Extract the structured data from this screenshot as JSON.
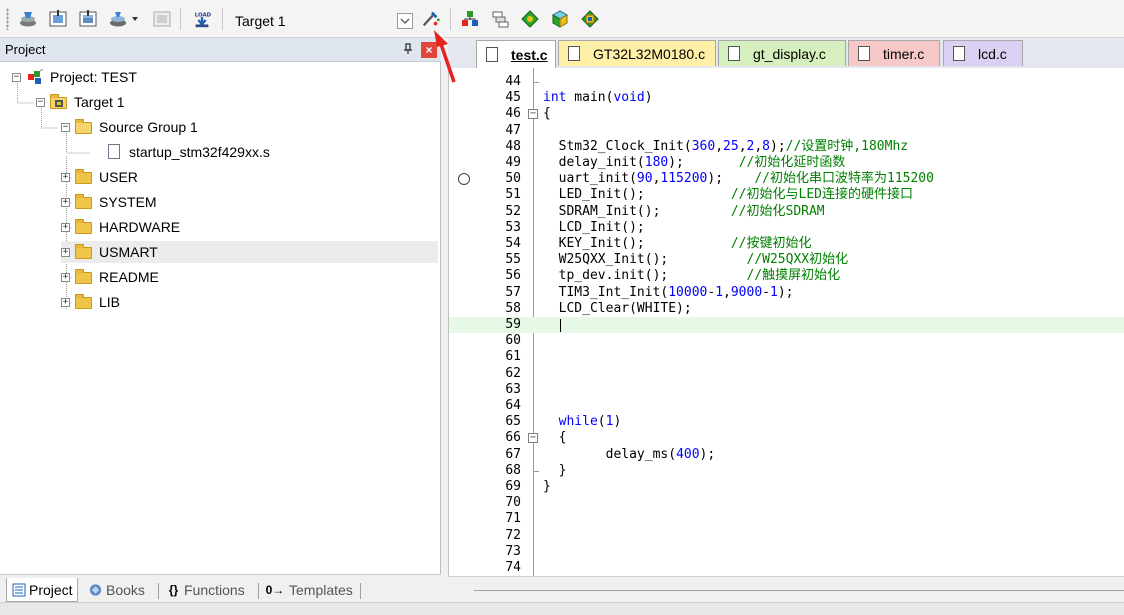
{
  "toolbar": {
    "target_value": "Target 1",
    "load_label": "LOAD"
  },
  "project_pane": {
    "title": "Project",
    "pin_glyph": "ª",
    "close_glyph": "×",
    "tree": [
      {
        "label": "Project: TEST",
        "icon": "project-icon",
        "expander": "−"
      },
      {
        "label": "Target 1",
        "icon": "target-icon",
        "expander": "−"
      },
      {
        "label": "Source Group 1",
        "icon": "folder-open-icon",
        "expander": "−"
      },
      {
        "label": "startup_stm32f429xx.s",
        "icon": "file-icon",
        "expander": ""
      },
      {
        "label": "USER",
        "icon": "folder-icon",
        "expander": "+"
      },
      {
        "label": "SYSTEM",
        "icon": "folder-icon",
        "expander": "+"
      },
      {
        "label": "HARDWARE",
        "icon": "folder-icon",
        "expander": "+"
      },
      {
        "label": "USMART",
        "icon": "folder-icon",
        "expander": "+",
        "selected": true
      },
      {
        "label": "README",
        "icon": "folder-icon",
        "expander": "+"
      },
      {
        "label": "LIB",
        "icon": "folder-icon",
        "expander": "+"
      }
    ],
    "bottom_tabs": [
      {
        "label": "Project",
        "icon": "project-tab-icon",
        "active": true
      },
      {
        "label": "Books",
        "icon": "books-icon"
      },
      {
        "label": "Functions",
        "icon": "functions-icon",
        "glyph": "{}"
      },
      {
        "label": "Templates",
        "icon": "templates-icon",
        "glyph": "0→"
      }
    ]
  },
  "editor_tabs": [
    {
      "label": "test.c",
      "active": true,
      "color": "#ffffff"
    },
    {
      "label": "GT32L32M0180.c",
      "color": "#fff0a8"
    },
    {
      "label": "gt_display.c",
      "color": "#d6efbf"
    },
    {
      "label": "timer.c",
      "color": "#f7c8c8"
    },
    {
      "label": "lcd.c",
      "color": "#d9d0f2"
    }
  ],
  "code_lines": [
    {
      "n": "44",
      "code": ""
    },
    {
      "n": "45",
      "code": "int main(void)"
    },
    {
      "n": "46",
      "code": "{"
    },
    {
      "n": "47",
      "code": ""
    },
    {
      "n": "48",
      "code": "  Stm32_Clock_Init(360,25,2,8);//设置时钟,180Mhz"
    },
    {
      "n": "49",
      "code": "  delay_init(180);       //初始化延时函数"
    },
    {
      "n": "50",
      "code": "  uart_init(90,115200);    //初始化串口波特率为115200"
    },
    {
      "n": "51",
      "code": "  LED_Init();           //初始化与LED连接的硬件接口"
    },
    {
      "n": "52",
      "code": "  SDRAM_Init();         //初始化SDRAM"
    },
    {
      "n": "53",
      "code": "  LCD_Init();"
    },
    {
      "n": "54",
      "code": "  KEY_Init();           //按键初始化"
    },
    {
      "n": "55",
      "code": "  W25QXX_Init();          //W25QXX初始化"
    },
    {
      "n": "56",
      "code": "  tp_dev.init();          //触摸屏初始化"
    },
    {
      "n": "57",
      "code": "  TIM3_Int_Init(10000-1,9000-1);"
    },
    {
      "n": "58",
      "code": "  LCD_Clear(WHITE);"
    },
    {
      "n": "59",
      "code": ""
    },
    {
      "n": "60",
      "code": ""
    },
    {
      "n": "61",
      "code": ""
    },
    {
      "n": "62",
      "code": ""
    },
    {
      "n": "63",
      "code": ""
    },
    {
      "n": "64",
      "code": ""
    },
    {
      "n": "65",
      "code": "  while(1)"
    },
    {
      "n": "66",
      "code": "  {"
    },
    {
      "n": "67",
      "code": "        delay_ms(400);"
    },
    {
      "n": "68",
      "code": "  }"
    },
    {
      "n": "69",
      "code": "}"
    },
    {
      "n": "70",
      "code": ""
    },
    {
      "n": "71",
      "code": ""
    },
    {
      "n": "72",
      "code": ""
    },
    {
      "n": "73",
      "code": ""
    },
    {
      "n": "74",
      "code": ""
    }
  ],
  "colors": {
    "keyword": "#0000ff",
    "comment": "#008000",
    "current_line": "#e6f8e6",
    "arrow": "#e8231f"
  }
}
